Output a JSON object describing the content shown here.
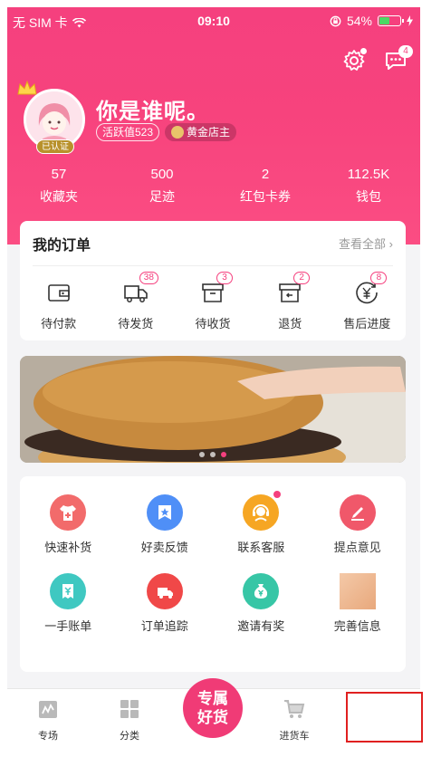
{
  "status": {
    "carrier": "无 SIM 卡",
    "time": "09:10",
    "battery": "54%",
    "battery_level": 0.54
  },
  "header": {
    "settings_icon": "gear-icon",
    "message_icon": "chat-icon",
    "message_count": "4"
  },
  "profile": {
    "verified_label": "已认证",
    "name": "你是谁呢。",
    "activity": "活跃值523",
    "level": "黄金店主"
  },
  "stats": [
    {
      "value": "57",
      "label": "收藏夹"
    },
    {
      "value": "500",
      "label": "足迹"
    },
    {
      "value": "2",
      "label": "红包卡券"
    },
    {
      "value": "112.5K",
      "label": "钱包"
    }
  ],
  "orders": {
    "title": "我的订单",
    "view_all": "查看全部",
    "items": [
      {
        "label": "待付款",
        "badge": "",
        "icon": "wallet-icon"
      },
      {
        "label": "待发货",
        "badge": "38",
        "icon": "truck-icon"
      },
      {
        "label": "待收货",
        "badge": "3",
        "icon": "box-icon"
      },
      {
        "label": "退货",
        "badge": "2",
        "icon": "return-icon"
      },
      {
        "label": "售后进度",
        "badge": "8",
        "icon": "yen-circle-icon"
      }
    ]
  },
  "banner": {
    "slides": 3,
    "active_slide": 3
  },
  "services": [
    {
      "label": "快速补货",
      "color": "#f26b6b",
      "icon": "shirt-plus-icon"
    },
    {
      "label": "好卖反馈",
      "color": "#4f8ff7",
      "icon": "star-badge-icon"
    },
    {
      "label": "联系客服",
      "color": "#f6a623",
      "icon": "headset-icon",
      "dot": true
    },
    {
      "label": "提点意见",
      "color": "#f0586a",
      "icon": "edit-icon"
    },
    {
      "label": "一手账单",
      "color": "#3fc8c1",
      "icon": "bill-icon"
    },
    {
      "label": "订单追踪",
      "color": "#f04848",
      "icon": "delivery-icon"
    },
    {
      "label": "邀请有奖",
      "color": "#37c6a6",
      "icon": "money-bag-icon"
    },
    {
      "label": "完善信息",
      "color": "",
      "icon": "photo"
    }
  ],
  "tabbar": {
    "tab1": "专场",
    "tab2": "分类",
    "center_line1": "专属",
    "center_line2": "好货",
    "tab4": "进货车"
  }
}
